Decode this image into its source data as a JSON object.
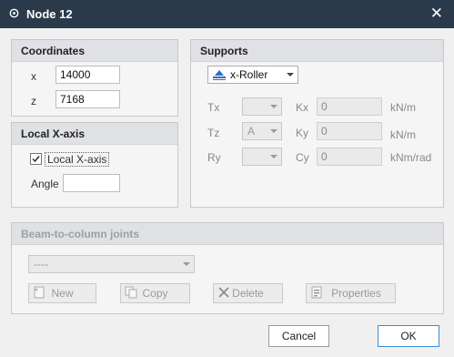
{
  "window": {
    "title": "Node 12",
    "close_glyph": "✕"
  },
  "coordinates": {
    "title": "Coordinates",
    "x_label": "x",
    "x_value": "14000",
    "z_label": "z",
    "z_value": "7168"
  },
  "local_x_axis": {
    "title": "Local X-axis",
    "checkbox_label": "Local X-axis",
    "checked": true,
    "angle_label": "Angle",
    "angle_value": ""
  },
  "supports": {
    "title": "Supports",
    "type_value": "x-Roller",
    "rows": [
      {
        "dof_label": "Tx",
        "dof_value": "",
        "stiff_label": "Kx",
        "stiff_value": "0",
        "unit": "kN/m"
      },
      {
        "dof_label": "Tz",
        "dof_value": "A",
        "stiff_label": "Ky",
        "stiff_value": "0",
        "unit": "kN/m"
      },
      {
        "dof_label": "Ry",
        "dof_value": "",
        "stiff_label": "Cy",
        "stiff_value": "0",
        "unit": "kNm/rad"
      }
    ]
  },
  "joints": {
    "title": "Beam-to-column joints",
    "select_value": "----",
    "buttons": {
      "new": "New",
      "copy": "Copy",
      "delete": "Delete",
      "properties": "Properties"
    }
  },
  "footer": {
    "cancel": "Cancel",
    "ok": "OK"
  },
  "colors": {
    "titlebar": "#2b3a4a",
    "ok_border": "#3c8dd0"
  }
}
